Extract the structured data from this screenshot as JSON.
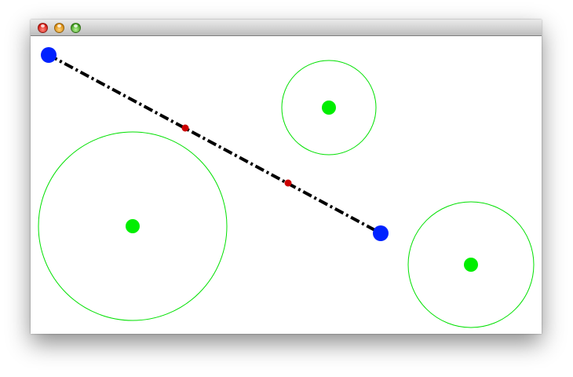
{
  "window": {
    "controls": [
      {
        "name": "close-button",
        "icon": "close-icon",
        "color": "#e0261c"
      },
      {
        "name": "minimize-button",
        "icon": "minimize-icon",
        "color": "#e69c16"
      },
      {
        "name": "zoom-button",
        "icon": "zoom-icon",
        "color": "#4cb52a"
      }
    ]
  },
  "scene": {
    "colors": {
      "circle_outline": "#00e000",
      "circle_center": "#00ee00",
      "segment_endpoint": "#0022ff",
      "segment_line": "#000000",
      "intersection_point": "#cc0000"
    },
    "line_style": "dash-dot",
    "circles": 3,
    "segment_endpoints": 2,
    "intersection_points": 2
  }
}
